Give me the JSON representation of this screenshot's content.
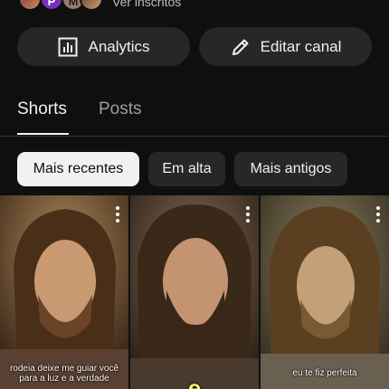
{
  "header": {
    "subscribers_link": "Ver inscritos",
    "avatars": [
      {
        "initial": ""
      },
      {
        "initial": "P",
        "color": "#7b2fbf"
      },
      {
        "initial": "M"
      },
      {
        "initial": ""
      }
    ]
  },
  "actions": {
    "analytics_label": "Analytics",
    "analytics_icon": "bar-chart-icon",
    "edit_label": "Editar canal",
    "edit_icon": "pencil-icon"
  },
  "tabs": [
    {
      "label": "Shorts",
      "active": true
    },
    {
      "label": "Posts",
      "active": false
    }
  ],
  "filters": [
    {
      "label": "Mais recentes",
      "selected": true
    },
    {
      "label": "Em alta",
      "selected": false
    },
    {
      "label": "Mais antigos",
      "selected": false
    }
  ],
  "shorts": [
    {
      "caption_line1": "rodeia deixe me guiar você",
      "caption_line2": "para a luz e a verdade"
    },
    {
      "caption": "e"
    },
    {
      "caption": "eu te fiz perfeita"
    }
  ],
  "colors": {
    "background": "#0f0f0f",
    "chip": "#272727",
    "chip_selected": "#f1f1f1",
    "caption_yellow": "#fffb6a"
  }
}
